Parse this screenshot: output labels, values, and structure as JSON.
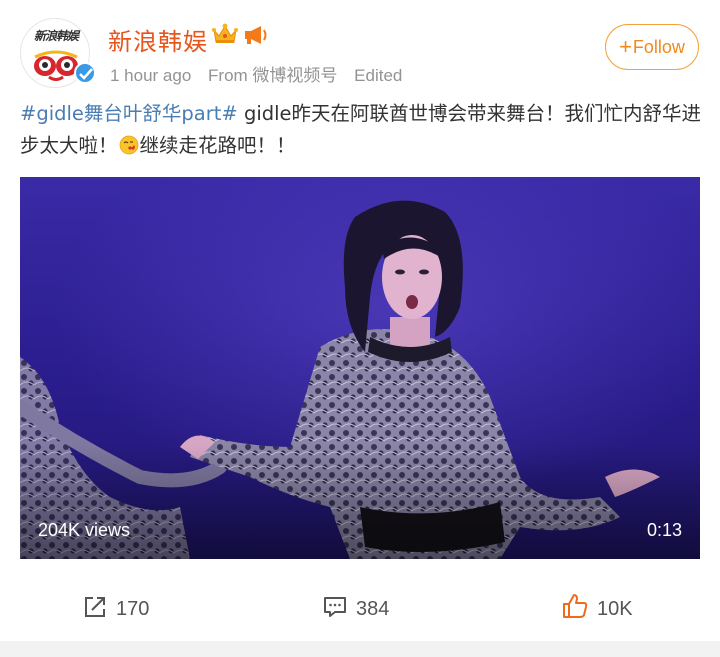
{
  "account": {
    "name": "新浪韩娱",
    "avatar_text": "新浪韩娱",
    "verified_icon": "verified-badge-icon",
    "badges": [
      "crown-icon",
      "megaphone-icon"
    ]
  },
  "meta": {
    "time": "1 hour ago",
    "source": "From 微博视频号",
    "edited": "Edited"
  },
  "follow_button": {
    "plus": "+",
    "label": "Follow"
  },
  "post": {
    "hashtag": "#gidle舞台叶舒华part#",
    "text_part1": " gidle昨天在阿联酋世博会带来舞台！我们忙内舒华进步太大啦！",
    "emoji": "blowing-kiss-emoji",
    "text_part2": "继续走花路吧！！"
  },
  "video": {
    "views": "204K views",
    "duration": "0:13"
  },
  "actions": {
    "share_count": "170",
    "comment_count": "384",
    "like_count": "10K"
  },
  "colors": {
    "username": "#e8541c",
    "hashtag": "#4b7db5",
    "follow": "#f08a1f",
    "like": "#f06a1e",
    "meta": "#939393"
  }
}
